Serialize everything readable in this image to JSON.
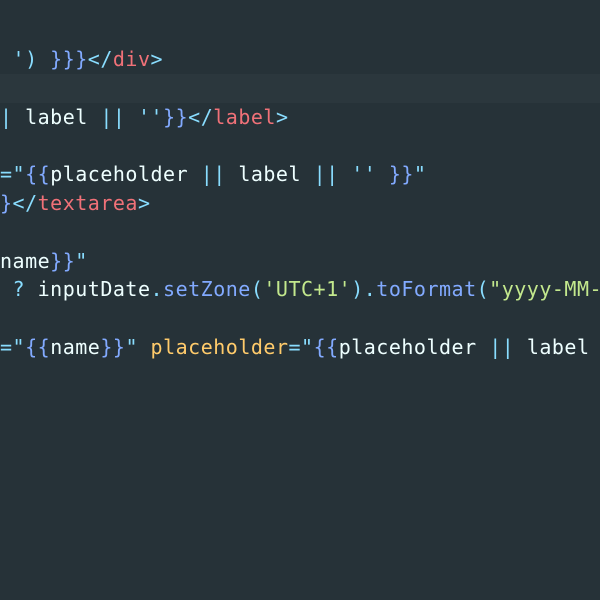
{
  "editor": {
    "theme_colors": {
      "background": "#263238",
      "current_line": "#2b373d",
      "text": "#eeffff",
      "punctuation": "#89ddff",
      "tag": "#f07178",
      "string": "#c3e88d",
      "attribute": "#ffcb6b",
      "method": "#82aaff",
      "brace": "#82aaff"
    },
    "lines": [
      {
        "tokens": [
          {
            "text": " ') ",
            "color": "#89ddff"
          },
          {
            "text": "}}}",
            "color": "#82aaff"
          },
          {
            "text": "</",
            "color": "#89ddff"
          },
          {
            "text": "div",
            "color": "#f07178"
          },
          {
            "text": ">",
            "color": "#89ddff"
          }
        ]
      },
      {
        "current": true,
        "tokens": []
      },
      {
        "tokens": [
          {
            "text": "| ",
            "color": "#89ddff"
          },
          {
            "text": "label ",
            "color": "#eeffff"
          },
          {
            "text": "|| ",
            "color": "#89ddff"
          },
          {
            "text": "''",
            "color": "#89ddff"
          },
          {
            "text": "}}",
            "color": "#82aaff"
          },
          {
            "text": "</",
            "color": "#89ddff"
          },
          {
            "text": "label",
            "color": "#f07178"
          },
          {
            "text": ">",
            "color": "#89ddff"
          }
        ]
      },
      {
        "tokens": []
      },
      {
        "tokens": [
          {
            "text": "=\"",
            "color": "#89ddff"
          },
          {
            "text": "{{",
            "color": "#82aaff"
          },
          {
            "text": "placeholder ",
            "color": "#eeffff"
          },
          {
            "text": "|| ",
            "color": "#89ddff"
          },
          {
            "text": "label ",
            "color": "#eeffff"
          },
          {
            "text": "|| ",
            "color": "#89ddff"
          },
          {
            "text": "'' ",
            "color": "#89ddff"
          },
          {
            "text": "}}",
            "color": "#82aaff"
          },
          {
            "text": "\"",
            "color": "#89ddff"
          }
        ]
      },
      {
        "tokens": [
          {
            "text": "}",
            "color": "#82aaff"
          },
          {
            "text": "</",
            "color": "#89ddff"
          },
          {
            "text": "textarea",
            "color": "#f07178"
          },
          {
            "text": ">",
            "color": "#89ddff"
          }
        ]
      },
      {
        "tokens": []
      },
      {
        "tokens": [
          {
            "text": "name",
            "color": "#eeffff"
          },
          {
            "text": "}}",
            "color": "#82aaff"
          },
          {
            "text": "\"",
            "color": "#89ddff"
          }
        ]
      },
      {
        "tokens": [
          {
            "text": " ? ",
            "color": "#89ddff"
          },
          {
            "text": "inputDate",
            "color": "#eeffff"
          },
          {
            "text": ".",
            "color": "#89ddff"
          },
          {
            "text": "setZone",
            "color": "#82aaff"
          },
          {
            "text": "(",
            "color": "#89ddff"
          },
          {
            "text": "'UTC+1'",
            "color": "#c3e88d"
          },
          {
            "text": ").",
            "color": "#89ddff"
          },
          {
            "text": "toFormat",
            "color": "#82aaff"
          },
          {
            "text": "(",
            "color": "#89ddff"
          },
          {
            "text": "\"yyyy-MM-",
            "color": "#c3e88d"
          }
        ]
      },
      {
        "tokens": []
      },
      {
        "tokens": [
          {
            "text": "=\"",
            "color": "#89ddff"
          },
          {
            "text": "{{",
            "color": "#82aaff"
          },
          {
            "text": "name",
            "color": "#eeffff"
          },
          {
            "text": "}}",
            "color": "#82aaff"
          },
          {
            "text": "\" ",
            "color": "#89ddff"
          },
          {
            "text": "placeholder",
            "color": "#ffcb6b"
          },
          {
            "text": "=\"",
            "color": "#89ddff"
          },
          {
            "text": "{{",
            "color": "#82aaff"
          },
          {
            "text": "placeholder ",
            "color": "#eeffff"
          },
          {
            "text": "|| ",
            "color": "#89ddff"
          },
          {
            "text": "label",
            "color": "#eeffff"
          }
        ]
      }
    ]
  }
}
